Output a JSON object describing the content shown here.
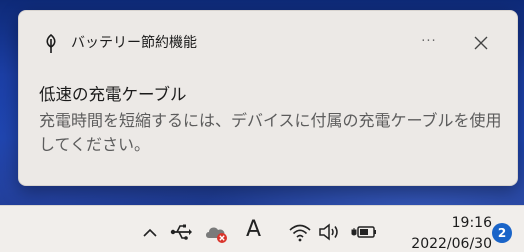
{
  "notification": {
    "app_name": "バッテリー節約機能",
    "title": "低速の充電ケーブル",
    "body": "充電時間を短縮するには、デバイスに付属の充電ケーブルを使用してください。",
    "more_label": "···",
    "icons": {
      "app": "battery-saver-leaf-icon",
      "close": "close-icon"
    }
  },
  "taskbar": {
    "tray_icons": [
      "chevron-up-icon",
      "usb-icon",
      "cloud-error-icon",
      "ime-mode-icon",
      "wifi-icon",
      "speaker-icon",
      "battery-charging-icon"
    ],
    "ime_label": "A",
    "time": "19:16",
    "date": "2022/06/30",
    "notification_count": "2",
    "colors": {
      "badge": "#1a64c8",
      "cloud_error": "#d9342b"
    }
  }
}
